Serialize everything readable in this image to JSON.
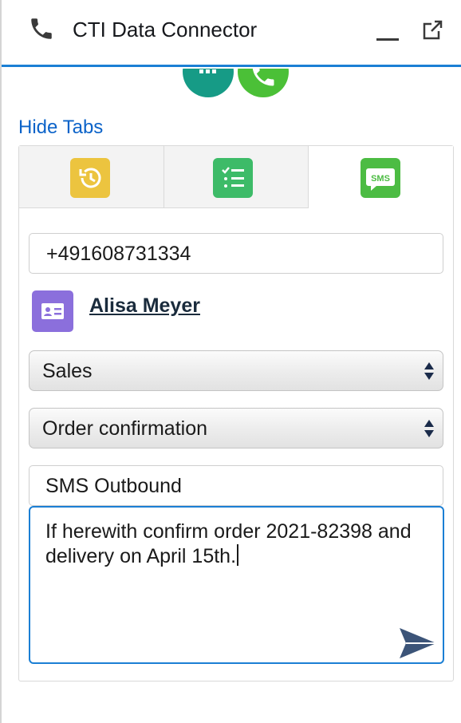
{
  "header": {
    "title": "CTI Data Connector",
    "phone_icon": "phone-icon",
    "minimize_icon": "minimize-icon",
    "popout_icon": "popout-icon"
  },
  "call_controls": {
    "dialpad_icon": "dialpad-icon",
    "call_icon": "call-icon",
    "dialpad_color": "#169b86",
    "call_color": "#4bc037"
  },
  "hide_tabs_label": "Hide Tabs",
  "tabs": [
    {
      "icon": "history-icon",
      "color": "#ecc43f",
      "active": false
    },
    {
      "icon": "task-list-icon",
      "color": "#3dbb68",
      "active": false
    },
    {
      "icon": "sms-icon",
      "label": "SMS",
      "color": "#4cbc43",
      "active": true
    }
  ],
  "sms_form": {
    "phone_number": "+491608731334",
    "contact": {
      "icon": "contact-card-icon",
      "name": "Alisa Meyer",
      "icon_color": "#8b6fdc"
    },
    "category_select": {
      "value": "Sales"
    },
    "template_select": {
      "value": "Order confirmation"
    },
    "subject": "SMS Outbound",
    "message": "If herewith confirm order 2021-82398 and delivery on April 15th.",
    "send_icon": "send-icon"
  },
  "colors": {
    "accent": "#1b7fd4",
    "link": "#0b63c9"
  }
}
